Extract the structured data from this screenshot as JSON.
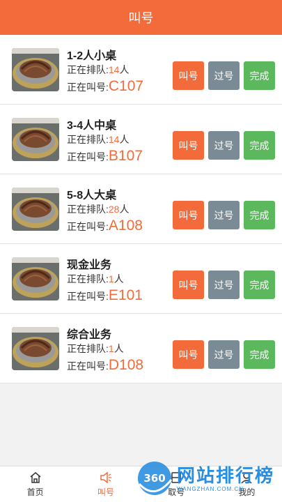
{
  "header": {
    "title": "叫号"
  },
  "labels": {
    "queue_prefix": "正在排队:",
    "queue_unit": "人",
    "calling_prefix": "正在叫号:"
  },
  "buttons": {
    "call": "叫号",
    "skip": "过号",
    "done": "完成"
  },
  "rows": [
    {
      "title": "1-2人小桌",
      "queue_count": "14",
      "calling_code": "C107"
    },
    {
      "title": "3-4人中桌",
      "queue_count": "14",
      "calling_code": "B107"
    },
    {
      "title": "5-8人大桌",
      "queue_count": "28",
      "calling_code": "A108"
    },
    {
      "title": "现金业务",
      "queue_count": "1",
      "calling_code": "E101"
    },
    {
      "title": "综合业务",
      "queue_count": "1",
      "calling_code": "D108"
    }
  ],
  "tabs": [
    {
      "label": "首页",
      "icon": "home-icon",
      "active": false
    },
    {
      "label": "叫号",
      "icon": "speaker-icon",
      "active": true
    },
    {
      "label": "取号",
      "icon": "ticket-icon",
      "active": false
    },
    {
      "label": "我的",
      "icon": "user-icon",
      "active": false
    }
  ],
  "watermark": {
    "logo": "360",
    "main": "网站排行榜",
    "sub": "WANGZHAN.COM.CN"
  },
  "colors": {
    "accent": "#f36b3b",
    "skip": "#7b8b95",
    "done": "#5cb85c",
    "watermark": "#2a8ee0"
  }
}
